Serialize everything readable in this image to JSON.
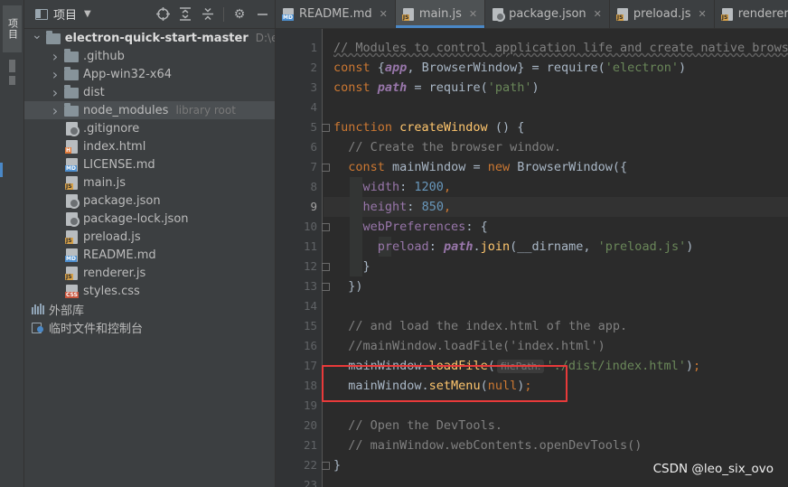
{
  "toolstrip": {
    "project_tab_label": "项目"
  },
  "project_panel": {
    "title": "项目",
    "tools": {
      "locate_icon": "crosshair-icon",
      "collapse_icon": "collapse-all-icon",
      "expand_icon": "expand-all-icon",
      "settings_icon": "gear-icon",
      "hide_icon": "minimize-icon"
    },
    "tree": [
      {
        "level": 0,
        "type": "folder",
        "expanded": true,
        "label": "electron-quick-start-master",
        "hint": "D:\\electron"
      },
      {
        "level": 1,
        "type": "folder",
        "expanded": false,
        "label": ".github",
        "hint": ""
      },
      {
        "level": 1,
        "type": "folder",
        "expanded": false,
        "label": "App-win32-x64",
        "hint": ""
      },
      {
        "level": 1,
        "type": "folder",
        "expanded": false,
        "label": "dist",
        "hint": ""
      },
      {
        "level": 1,
        "type": "folder",
        "expanded": false,
        "label": "node_modules",
        "hint": "library root",
        "selected": true
      },
      {
        "level": 1,
        "type": "gear",
        "label": ".gitignore",
        "hint": ""
      },
      {
        "level": 1,
        "type": "html",
        "label": "index.html",
        "hint": ""
      },
      {
        "level": 1,
        "type": "md",
        "label": "LICENSE.md",
        "hint": ""
      },
      {
        "level": 1,
        "type": "js",
        "label": "main.js",
        "hint": ""
      },
      {
        "level": 1,
        "type": "gear",
        "label": "package.json",
        "hint": ""
      },
      {
        "level": 1,
        "type": "gear",
        "label": "package-lock.json",
        "hint": ""
      },
      {
        "level": 1,
        "type": "js",
        "label": "preload.js",
        "hint": ""
      },
      {
        "level": 1,
        "type": "md",
        "label": "README.md",
        "hint": ""
      },
      {
        "level": 1,
        "type": "js",
        "label": "renderer.js",
        "hint": ""
      },
      {
        "level": 1,
        "type": "css",
        "label": "styles.css",
        "hint": ""
      },
      {
        "level": 0,
        "type": "lib",
        "label": "外部库",
        "hint": ""
      },
      {
        "level": 0,
        "type": "scratch",
        "label": "临时文件和控制台",
        "hint": ""
      }
    ]
  },
  "editor": {
    "tabs": [
      {
        "label": "README.md",
        "icon": "md",
        "active": false
      },
      {
        "label": "main.js",
        "icon": "js",
        "active": true
      },
      {
        "label": "package.json",
        "icon": "gear",
        "active": false
      },
      {
        "label": "preload.js",
        "icon": "js",
        "active": false
      },
      {
        "label": "renderer.js",
        "icon": "js",
        "active": false
      }
    ],
    "current_line": 9,
    "lines": [
      {
        "n": 1,
        "tokens": [
          [
            "comment",
            "// Modules to control application life and create native browser"
          ]
        ]
      },
      {
        "n": 2,
        "tokens": [
          [
            "kw",
            "const "
          ],
          [
            "plain",
            "{"
          ],
          [
            "var",
            "app"
          ],
          [
            "plain",
            ", BrowserWindow} = require("
          ],
          [
            "str",
            "'electron'"
          ],
          [
            "plain",
            ")"
          ]
        ]
      },
      {
        "n": 3,
        "tokens": [
          [
            "kw",
            "const "
          ],
          [
            "var",
            "path"
          ],
          [
            "plain",
            " = require("
          ],
          [
            "str",
            "'path'"
          ],
          [
            "plain",
            ")"
          ]
        ]
      },
      {
        "n": 4,
        "tokens": []
      },
      {
        "n": 5,
        "tokens": [
          [
            "kw",
            "function "
          ],
          [
            "fn",
            "createWindow"
          ],
          [
            "plain",
            " () {"
          ]
        ]
      },
      {
        "n": 6,
        "tokens": [
          [
            "plain",
            "  "
          ],
          [
            "comment",
            "// Create the browser window."
          ]
        ]
      },
      {
        "n": 7,
        "tokens": [
          [
            "plain",
            "  "
          ],
          [
            "kw",
            "const "
          ],
          [
            "plain",
            "mainWindow = "
          ],
          [
            "kw",
            "new "
          ],
          [
            "plain",
            "BrowserWindow({"
          ]
        ]
      },
      {
        "n": 8,
        "tokens": [
          [
            "plain",
            "    "
          ],
          [
            "prop",
            "width"
          ],
          [
            "plain",
            ": "
          ],
          [
            "num",
            "1200"
          ],
          [
            "kw",
            ","
          ]
        ]
      },
      {
        "n": 9,
        "tokens": [
          [
            "plain",
            "    "
          ],
          [
            "prop",
            "height"
          ],
          [
            "plain",
            ": "
          ],
          [
            "num",
            "850"
          ],
          [
            "kw",
            ","
          ]
        ]
      },
      {
        "n": 10,
        "tokens": [
          [
            "plain",
            "    "
          ],
          [
            "prop",
            "webPreferences"
          ],
          [
            "plain",
            ": {"
          ]
        ]
      },
      {
        "n": 11,
        "tokens": [
          [
            "plain",
            "      "
          ],
          [
            "prop",
            "preload"
          ],
          [
            "plain",
            ": "
          ],
          [
            "var",
            "path"
          ],
          [
            "plain",
            "."
          ],
          [
            "fn",
            "join"
          ],
          [
            "plain",
            "(__dirname, "
          ],
          [
            "str",
            "'preload.js'"
          ],
          [
            "plain",
            ")"
          ]
        ]
      },
      {
        "n": 12,
        "tokens": [
          [
            "plain",
            "    }"
          ]
        ]
      },
      {
        "n": 13,
        "tokens": [
          [
            "plain",
            "  })"
          ]
        ]
      },
      {
        "n": 14,
        "tokens": []
      },
      {
        "n": 15,
        "tokens": [
          [
            "plain",
            "  "
          ],
          [
            "comment",
            "// and load the index.html of the app."
          ]
        ]
      },
      {
        "n": 16,
        "tokens": [
          [
            "plain",
            "  "
          ],
          [
            "comment",
            "//mainWindow.loadFile('index.html')"
          ]
        ]
      },
      {
        "n": 17,
        "tokens": [
          [
            "plain",
            "  mainWindow."
          ],
          [
            "fn",
            "loadFile"
          ],
          [
            "plain",
            "("
          ],
          [
            "hint",
            "filePath:"
          ],
          [
            "str",
            "'./dist/index.html'"
          ],
          [
            "plain",
            ")"
          ],
          [
            "kw",
            ";"
          ]
        ]
      },
      {
        "n": 18,
        "tokens": [
          [
            "plain",
            "  mainWindow."
          ],
          [
            "fn",
            "setMenu"
          ],
          [
            "plain",
            "("
          ],
          [
            "kw",
            "null"
          ],
          [
            "plain",
            ")"
          ],
          [
            "kw",
            ";"
          ]
        ]
      },
      {
        "n": 19,
        "tokens": []
      },
      {
        "n": 20,
        "tokens": [
          [
            "plain",
            "  "
          ],
          [
            "comment",
            "// Open the DevTools."
          ]
        ]
      },
      {
        "n": 21,
        "tokens": [
          [
            "plain",
            "  "
          ],
          [
            "comment",
            "// mainWindow.webContents.openDevTools()"
          ]
        ]
      },
      {
        "n": 22,
        "tokens": [
          [
            "plain",
            "}"
          ]
        ]
      },
      {
        "n": 23,
        "tokens": []
      }
    ],
    "annotation": {
      "type": "red-box",
      "lines": [
        18,
        19
      ],
      "color": "#e83a3a"
    }
  },
  "watermark": "CSDN @leo_six_ovo",
  "colors": {
    "accent": "#4a88c7",
    "keyword": "#cc7832",
    "string": "#6a8759",
    "comment": "#808080",
    "property": "#9876aa",
    "function": "#ffc66d",
    "number": "#6897bb"
  }
}
